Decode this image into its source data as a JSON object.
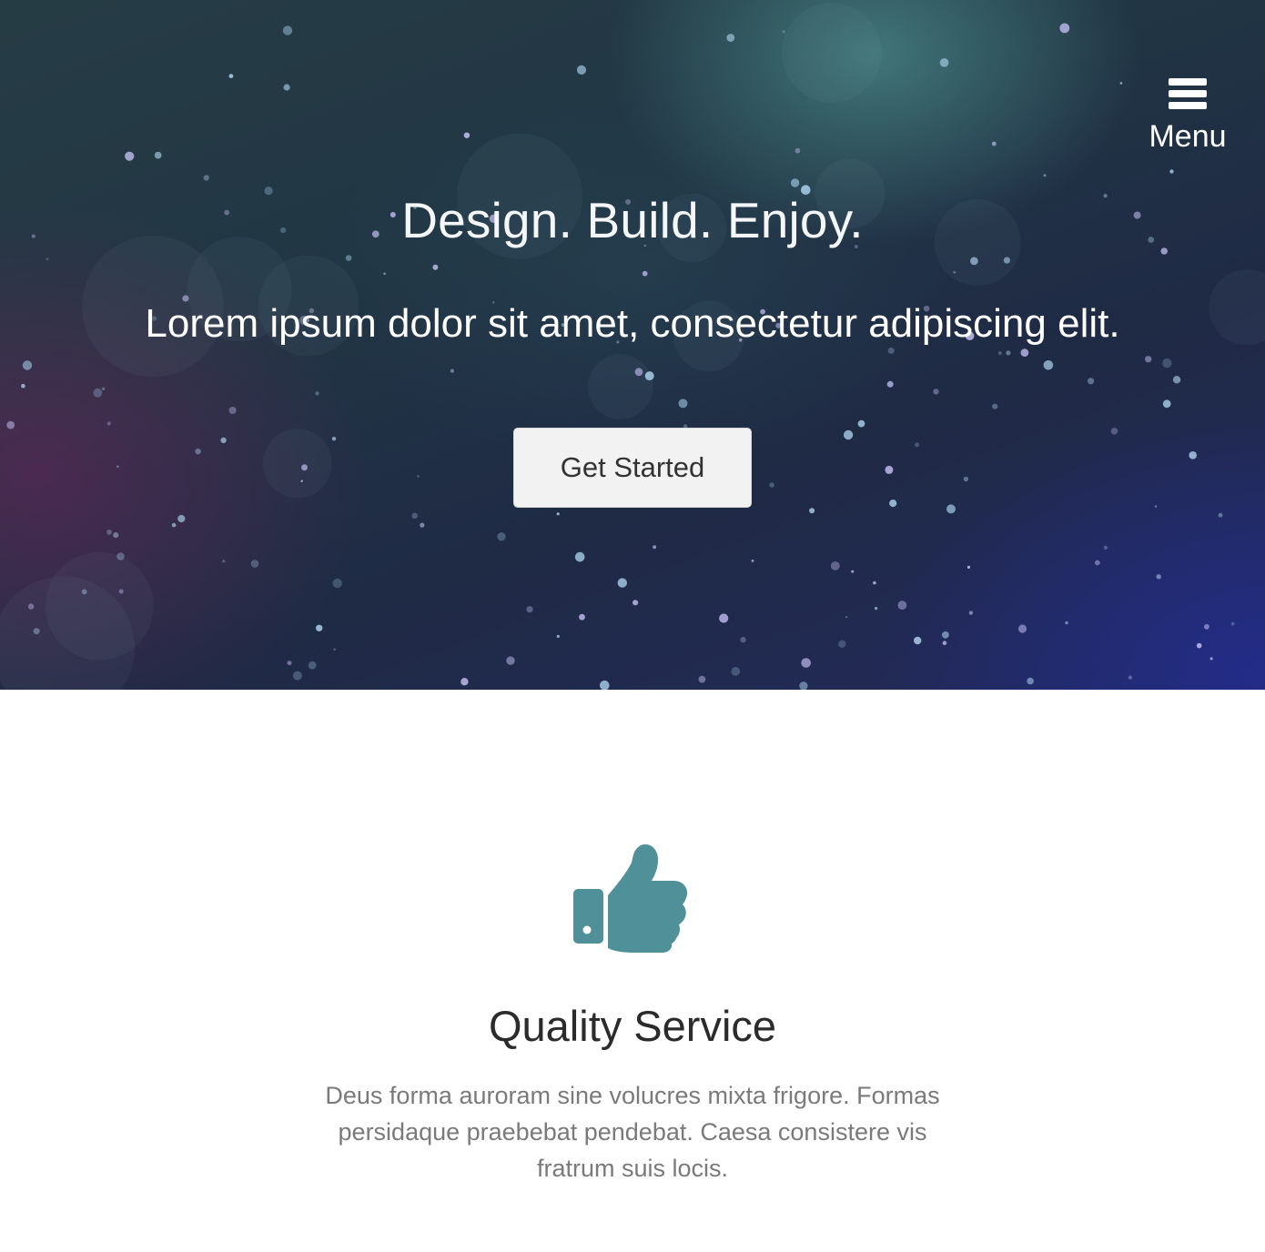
{
  "colors": {
    "accent": "#4f9099",
    "hero_title": "#f4f6f8",
    "button_bg": "#f2f2f2",
    "body_text": "#7a7a7a",
    "heading_text": "#2b2b2b"
  },
  "nav": {
    "menu_label": "Menu",
    "menu_icon": "hamburger-icon"
  },
  "hero": {
    "title": "Design. Build. Enjoy.",
    "subtitle": "Lorem ipsum dolor sit amet, consectetur adipiscing elit.",
    "cta_label": "Get Started"
  },
  "services": {
    "items": [
      {
        "icon": "thumbs-up-icon",
        "title": "Quality Service",
        "text": "Deus forma auroram sine volucres mixta frigore. Formas persidaque praebebat pendebat. Caesa consistere vis fratrum suis locis."
      }
    ]
  }
}
